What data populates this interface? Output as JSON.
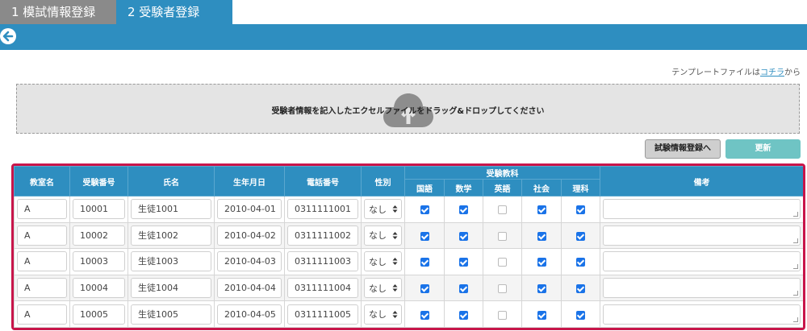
{
  "tabs": [
    {
      "label": "1 模試情報登録",
      "active": false
    },
    {
      "label": "2 受験者登録",
      "active": true
    }
  ],
  "template_note": {
    "prefix": "テンプレートファイルは",
    "link": "コチラ",
    "suffix": "から"
  },
  "dropzone": {
    "text": "受験者情報を記入したエクセルファイルをドラッグ&ドロップしてください"
  },
  "buttons": {
    "register": "試験情報登録へ",
    "update": "更新"
  },
  "table": {
    "headers": {
      "room": "教室名",
      "number": "受験番号",
      "name": "氏名",
      "birthday": "生年月日",
      "phone": "電話番号",
      "gender": "性別",
      "subjects": "受験教科",
      "notes": "備考"
    },
    "subjects": [
      "国語",
      "数学",
      "英語",
      "社会",
      "理科"
    ],
    "rows": [
      {
        "room": "A",
        "number": "10001",
        "name": "生徒1001",
        "birthday": "2010-04-01",
        "phone": "0311111001",
        "gender": "なし",
        "subjects": [
          true,
          true,
          false,
          true,
          true
        ]
      },
      {
        "room": "A",
        "number": "10002",
        "name": "生徒1002",
        "birthday": "2010-04-02",
        "phone": "0311111002",
        "gender": "なし",
        "subjects": [
          true,
          true,
          false,
          true,
          true
        ]
      },
      {
        "room": "A",
        "number": "10003",
        "name": "生徒1003",
        "birthday": "2010-04-03",
        "phone": "0311111003",
        "gender": "なし",
        "subjects": [
          true,
          true,
          false,
          true,
          true
        ]
      },
      {
        "room": "A",
        "number": "10004",
        "name": "生徒1004",
        "birthday": "2010-04-04",
        "phone": "0311111004",
        "gender": "なし",
        "subjects": [
          true,
          true,
          false,
          true,
          true
        ]
      },
      {
        "room": "A",
        "number": "10005",
        "name": "生徒1005",
        "birthday": "2010-04-05",
        "phone": "0311111005",
        "gender": "なし",
        "subjects": [
          true,
          true,
          false,
          true,
          true
        ]
      }
    ]
  },
  "colors": {
    "accent": "#2e8ec0",
    "highlight_border": "#c8154a",
    "update_button": "#6fc4c4",
    "checkbox": "#1a73e8"
  },
  "icons": {
    "back": "arrow-left-circle-icon",
    "upload": "cloud-upload-icon",
    "select": "select-arrows-icon"
  }
}
